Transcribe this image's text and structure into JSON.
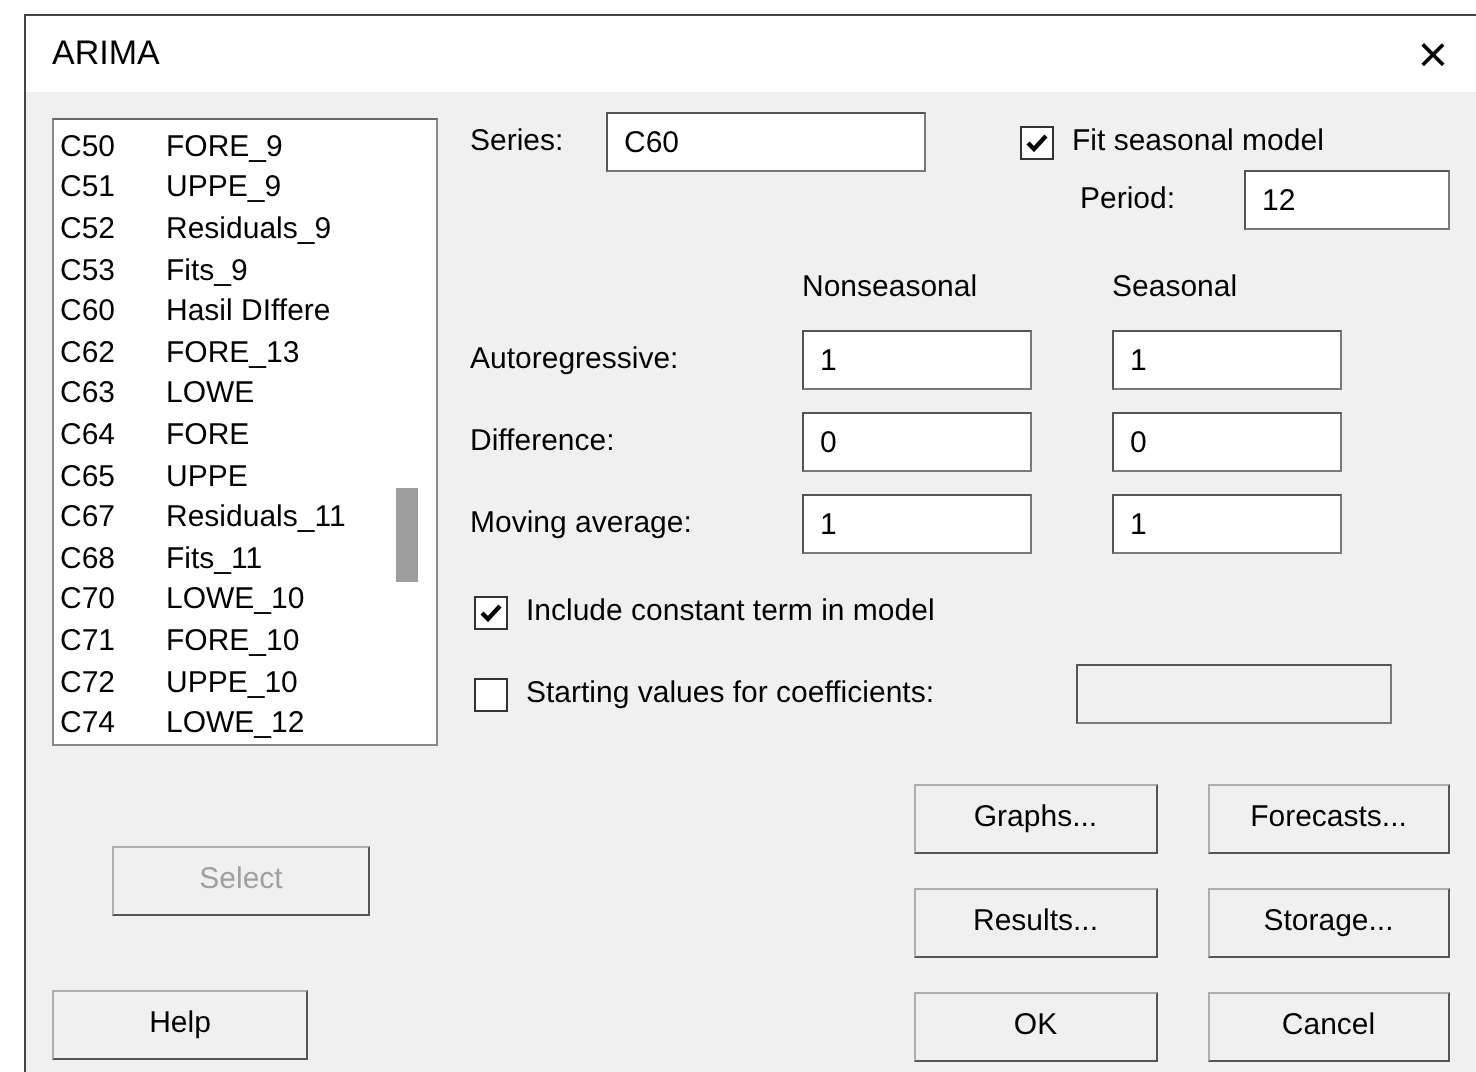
{
  "window": {
    "title": "ARIMA",
    "close": "×"
  },
  "variables": [
    {
      "column": "C50",
      "name": "FORE_9"
    },
    {
      "column": "C51",
      "name": "UPPE_9"
    },
    {
      "column": "C52",
      "name": "Residuals_9"
    },
    {
      "column": "C53",
      "name": "Fits_9"
    },
    {
      "column": "C60",
      "name": "Hasil DIffere"
    },
    {
      "column": "C62",
      "name": "FORE_13"
    },
    {
      "column": "C63",
      "name": "LOWE"
    },
    {
      "column": "C64",
      "name": "FORE"
    },
    {
      "column": "C65",
      "name": "UPPE"
    },
    {
      "column": "C67",
      "name": "Residuals_11"
    },
    {
      "column": "C68",
      "name": "Fits_11"
    },
    {
      "column": "C70",
      "name": "LOWE_10"
    },
    {
      "column": "C71",
      "name": "FORE_10"
    },
    {
      "column": "C72",
      "name": "UPPE_10"
    },
    {
      "column": "C74",
      "name": "LOWE_12"
    }
  ],
  "select_button": {
    "label": "Select",
    "disabled": true
  },
  "series": {
    "label": "Series:",
    "value": "C60"
  },
  "seasonal": {
    "label": "Fit seasonal model",
    "checked": true,
    "period_label": "Period:",
    "period": "12"
  },
  "headers": [
    "Nonseasonal",
    "Seasonal"
  ],
  "parameters": [
    {
      "label": "Autoregressive:",
      "nonseasonal": "1",
      "seasonal": "1"
    },
    {
      "label": "Difference:",
      "nonseasonal": "0",
      "seasonal": "0"
    },
    {
      "label": "Moving average:",
      "nonseasonal": "1",
      "seasonal": "1"
    }
  ],
  "constant": {
    "label": "Include constant term in model",
    "checked": true
  },
  "starting_values": {
    "label": "Starting values for coefficients:",
    "checked": false
  },
  "buttons": [
    [
      "Graphs...",
      "Forecasts..."
    ],
    [
      "Results...",
      "Storage..."
    ],
    [
      "OK",
      "Cancel"
    ]
  ],
  "help_button": "Help"
}
